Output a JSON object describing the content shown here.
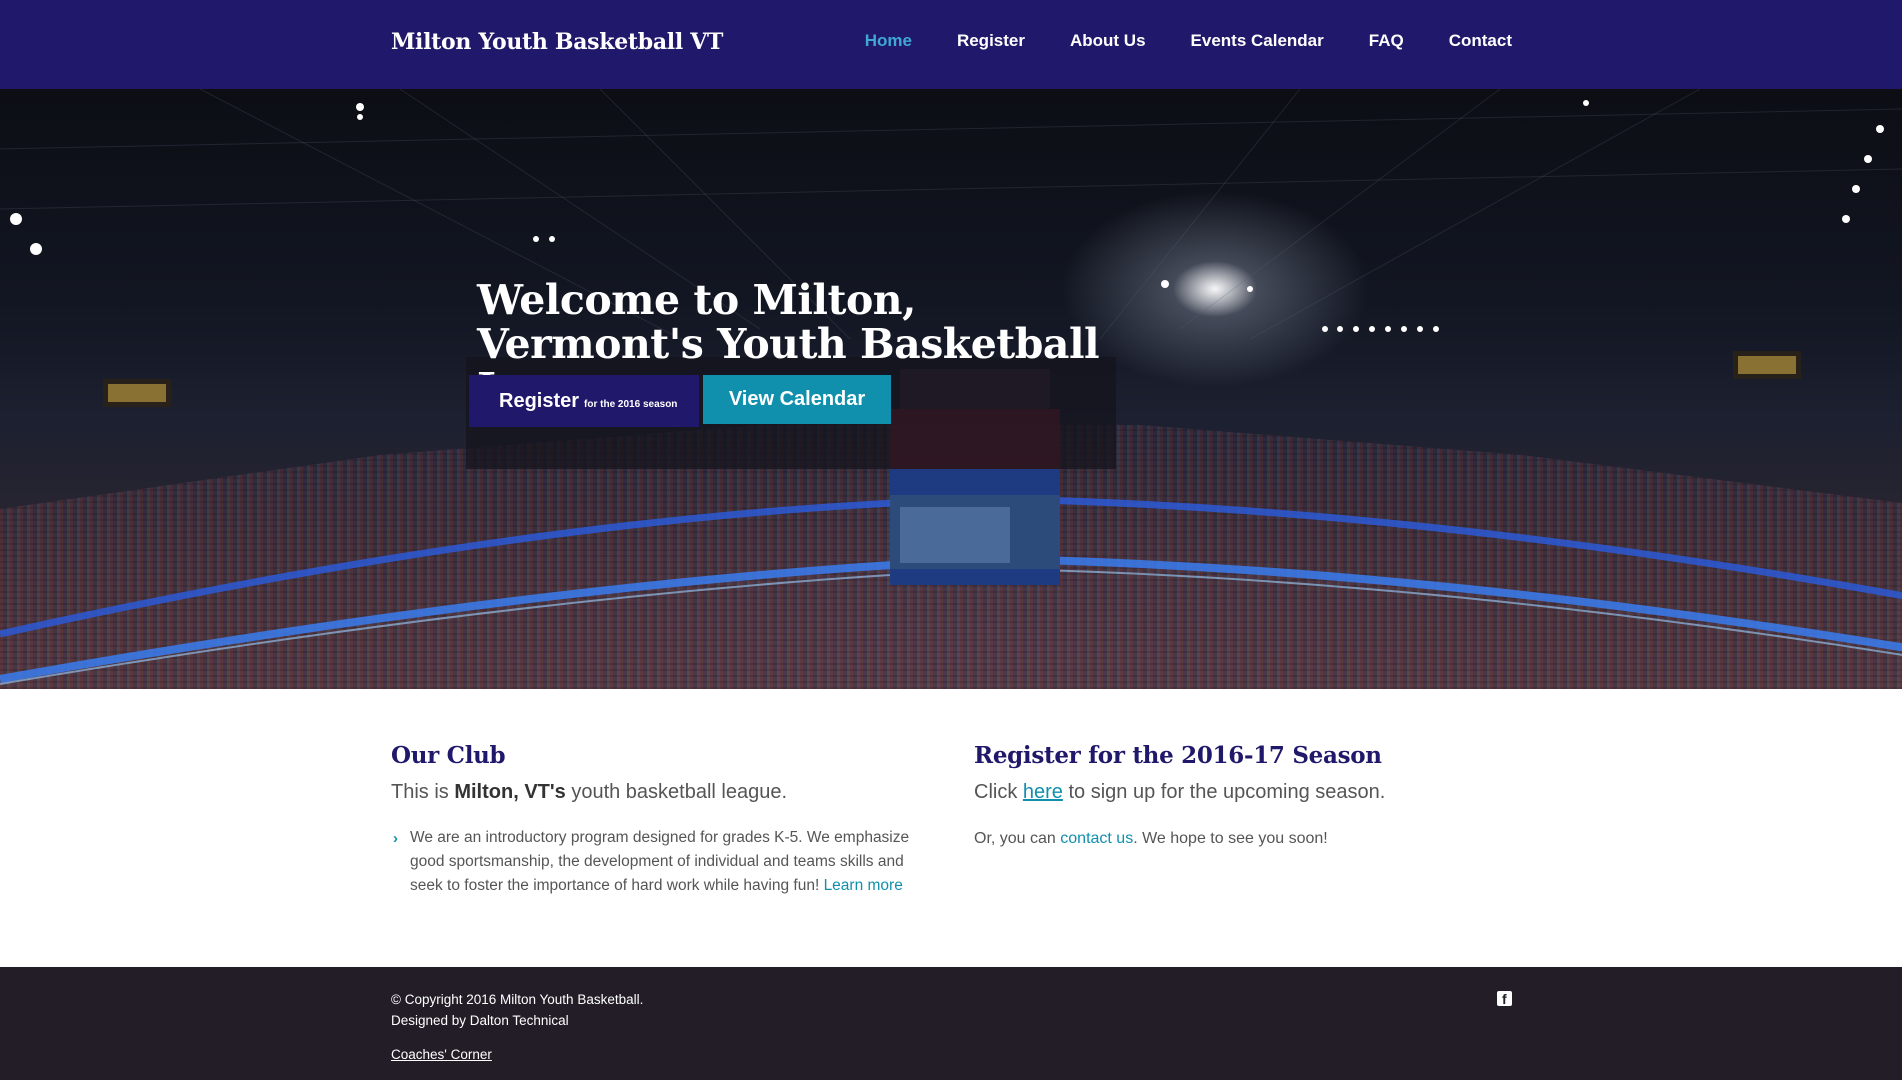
{
  "site": {
    "brand": "Milton Youth Basketball VT",
    "nav": [
      {
        "label": "Home",
        "active": true
      },
      {
        "label": "Register",
        "active": false
      },
      {
        "label": "About Us",
        "active": false
      },
      {
        "label": "Events Calendar",
        "active": false
      },
      {
        "label": "FAQ",
        "active": false
      },
      {
        "label": "Contact",
        "active": false
      }
    ]
  },
  "hero": {
    "title": "Welcome to Milton, Vermont's Youth Basketball League",
    "register_label": "Register",
    "register_sub": "for the 2016 season",
    "calendar_label": "View Calendar"
  },
  "club": {
    "title": "Our Club",
    "lead_prefix": "This is ",
    "lead_bold": "Milton, VT's",
    "lead_suffix": " youth basketball league.",
    "bullet_text": "We are an introductory program designed for grades K-5. We emphasize good sportsmanship, the development of individual and teams skills and seek to foster the importance of hard work while having fun! ",
    "learn_more": "Learn more"
  },
  "register": {
    "title": "Register for the 2016-17 Season",
    "lead_prefix": "Click ",
    "lead_link": "here",
    "lead_suffix": " to sign up for the upcoming season.",
    "secondary_prefix": "Or, you can ",
    "secondary_link": "contact us",
    "secondary_suffix": ". We hope to see you soon!"
  },
  "footer": {
    "copyright": "© Copyright 2016 Milton Youth Basketball.",
    "designed_by": "Designed by Dalton Technical",
    "coaches_link": "Coaches' Corner",
    "social_icon": "facebook-icon"
  },
  "colors": {
    "brand_navy": "#20186a",
    "accent_teal": "#1190ad",
    "nav_active": "#3fa7d2",
    "footer_bg": "#221d27"
  }
}
